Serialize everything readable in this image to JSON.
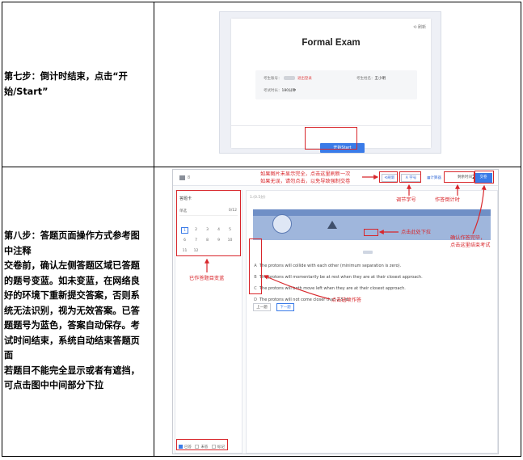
{
  "step7": {
    "text": "第七步：倒计时结束，点击“开始/Start”"
  },
  "step8": {
    "text": "第八步：答题页面操作方式参考图中注释\n交卷前，确认左侧答题区域已答题的题号变蓝。如未变蓝，在网络良好的环境下重新提交答案，否则系统无法识别，视为无效答案。已答题题号为蓝色，答案自动保存。考试时间结束，系统自动结束答题页面\n若题目不能完全显示或者有遮挡，可点击图中中间部分下拉"
  },
  "exam": {
    "refresh": "刷新",
    "title": "Formal Exam",
    "label_id": "考生账号：",
    "link_exit": "退出登录",
    "label_name": "考生姓名：",
    "name_value": "王小明",
    "label_time": "考试时长：",
    "time_value": "180分钟",
    "start_button": "开始Start"
  },
  "answer_page": {
    "user_label": "8",
    "btn_refresh": "刷新",
    "btn_font": "A 字号",
    "btn_calc": "计算器",
    "timer_label": "剩余时间",
    "timer_value": "29:51",
    "submit_button": "交卷",
    "sidebar_title": "答题卡",
    "section_label": "单选",
    "section_count": "0/12",
    "numbers": [
      "1",
      "2",
      "3",
      "4",
      "5",
      "6",
      "7",
      "8",
      "9",
      "10",
      "11",
      "12"
    ],
    "legend_answered": "已答",
    "legend_unanswered": "未答",
    "legend_marked": "标记",
    "question_header": "1.(0.5分)",
    "options": [
      {
        "letter": "A",
        "text": "The protons will collide with each other (minimum separation is zero)."
      },
      {
        "letter": "B",
        "text": "The protons will momentarily be at rest when they are at their closest approach."
      },
      {
        "letter": "C",
        "text": "The protons will both move left when they are at their closest approach."
      },
      {
        "letter": "D",
        "text": "The protons will not come closer than 2.5 m."
      }
    ],
    "prev_button": "上一题",
    "next_button": "下一题"
  },
  "annotations": {
    "refresh_note_1": "如果图片未显示完全，点击这里刷新一次",
    "refresh_note_2": "如果无误，请勿点击，以免导致强制交卷",
    "font_note": "调节字号",
    "timer_note": "作答倒计时",
    "pull_note": "点击此处下拉",
    "submit_note_1": "确认作答完毕，",
    "submit_note_2": "点击这里结束考试",
    "sidebar_note": "已作答题目变蓝",
    "options_note": "点击选项作答"
  }
}
